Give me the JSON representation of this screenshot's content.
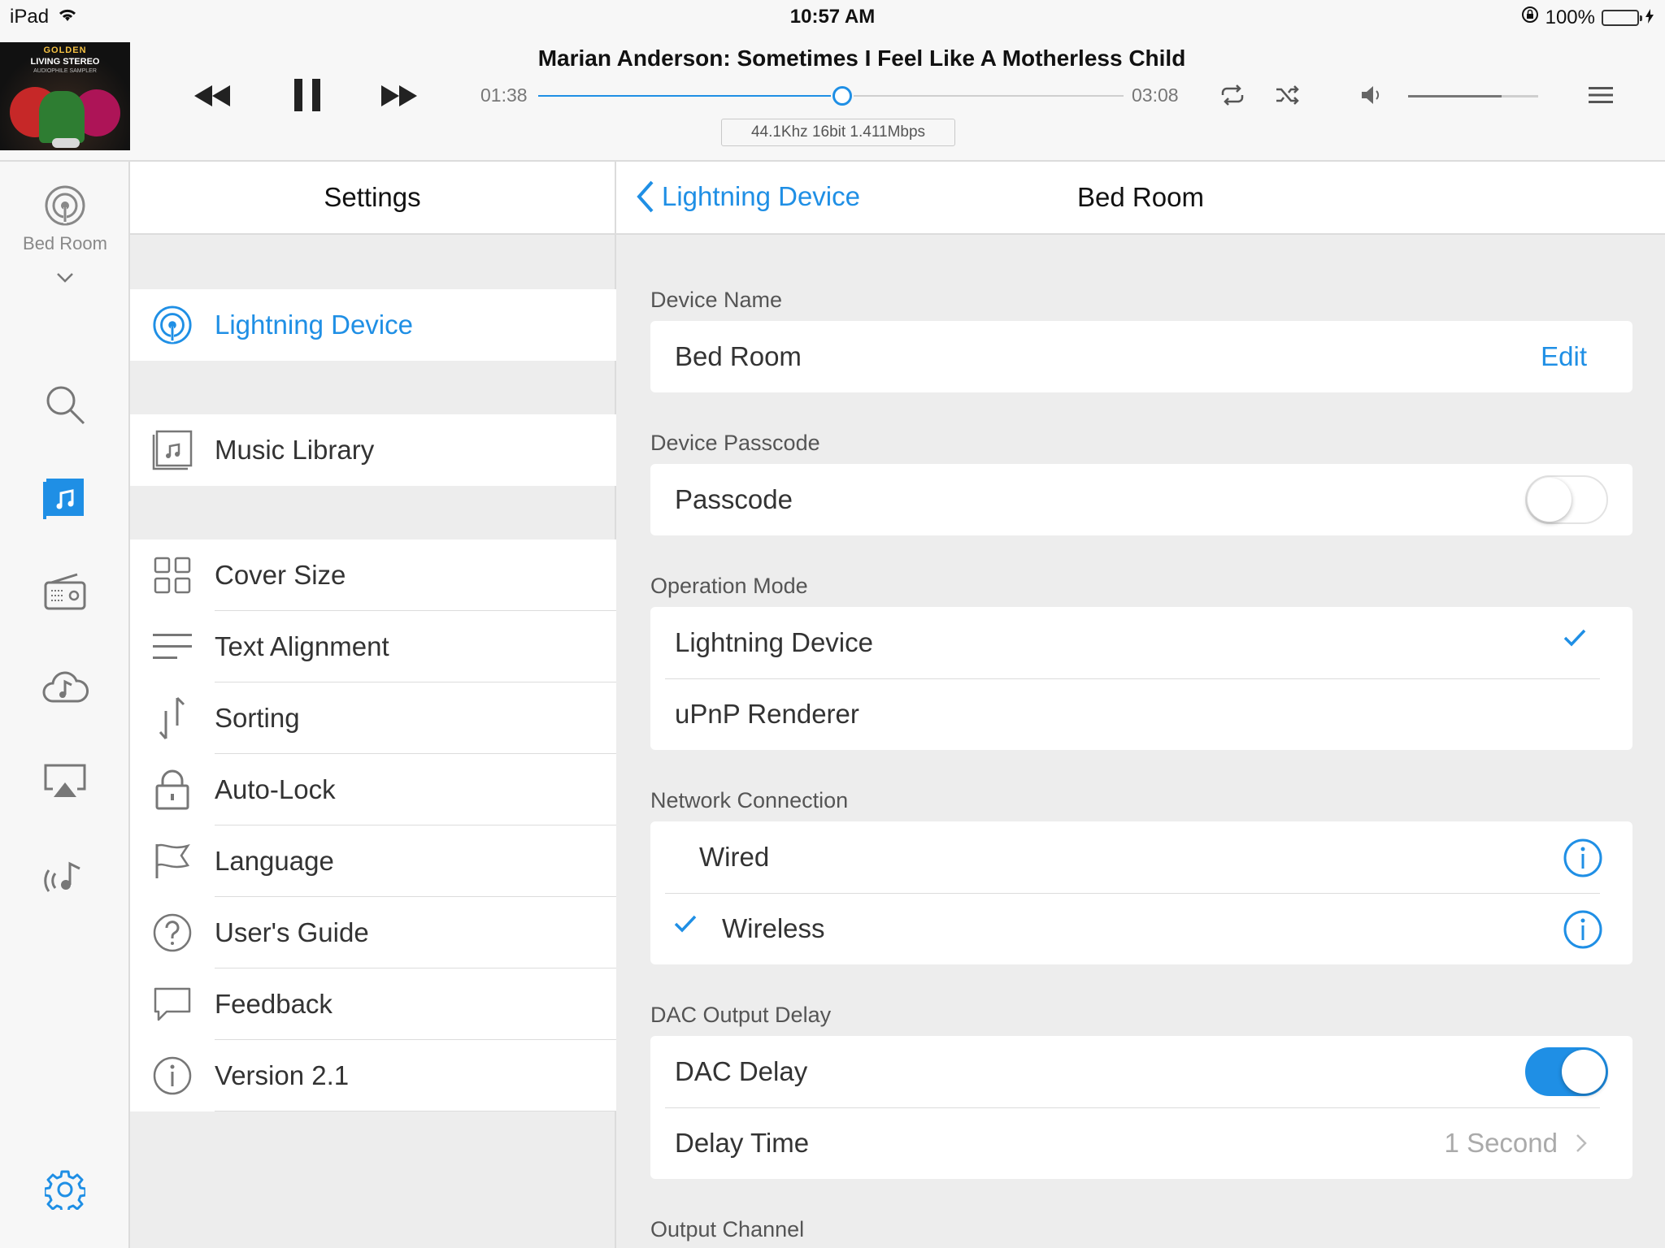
{
  "status": {
    "device": "iPad",
    "time": "10:57 AM",
    "battery": "100%"
  },
  "player": {
    "album": {
      "line1": "GOLDEN",
      "line2": "LIVING STEREO",
      "line3": "AUDIOPHILE SAMPLER"
    },
    "title": "Marian Anderson: Sometimes I Feel Like A Motherless Child",
    "elapsed": "01:38",
    "duration": "03:08",
    "progress": 0.52,
    "quality": "44.1Khz  16bit  1.411Mbps",
    "volume": 0.72
  },
  "rail": {
    "room_label": "Bed Room"
  },
  "settings": {
    "title": "Settings",
    "items": [
      {
        "label": "Lightning Device"
      },
      {
        "label": "Music Library"
      },
      {
        "label": "Cover Size"
      },
      {
        "label": "Text Alignment"
      },
      {
        "label": "Sorting"
      },
      {
        "label": "Auto-Lock"
      },
      {
        "label": "Language"
      },
      {
        "label": "User's Guide"
      },
      {
        "label": "Feedback"
      },
      {
        "label": "Version 2.1"
      }
    ]
  },
  "detail": {
    "back_label": "Lightning Device",
    "title": "Bed Room",
    "device_name": {
      "section": "Device Name",
      "value": "Bed Room",
      "action": "Edit"
    },
    "device_passcode": {
      "section": "Device Passcode",
      "label": "Passcode",
      "enabled": false
    },
    "operation_mode": {
      "section": "Operation Mode",
      "options": [
        "Lightning Device",
        "uPnP Renderer"
      ],
      "selected": "Lightning Device"
    },
    "network": {
      "section": "Network Connection",
      "options": [
        "Wired",
        "Wireless"
      ],
      "selected": "Wireless"
    },
    "dac": {
      "section": "DAC Output Delay",
      "delay_label": "DAC Delay",
      "enabled": true,
      "time_label": "Delay Time",
      "time_value": "1 Second"
    },
    "output_channel": {
      "section": "Output Channel"
    }
  },
  "colors": {
    "accent": "#1f8fe5",
    "battery": "#4cd964"
  }
}
